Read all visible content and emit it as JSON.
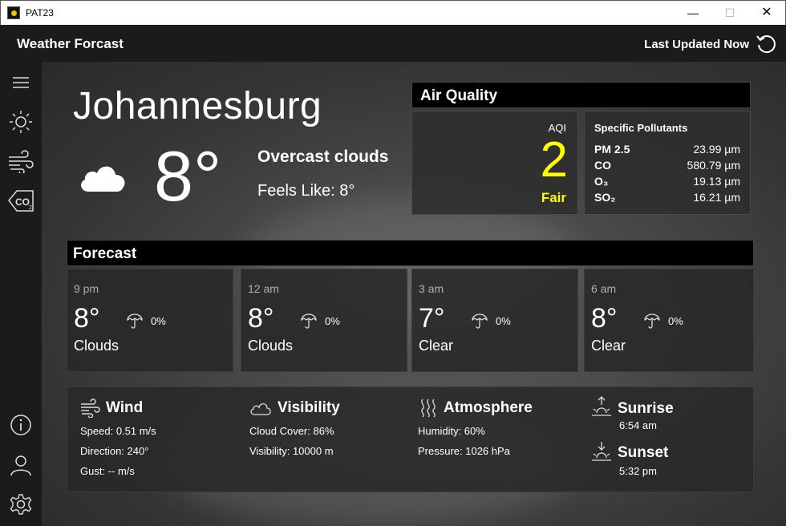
{
  "window": {
    "title": "PAT23",
    "minimize": "—",
    "maximize": "☐",
    "close": "✕"
  },
  "header": {
    "title": "Weather Forcast",
    "last_updated": "Last Updated Now"
  },
  "current": {
    "city": "Johannesburg",
    "temperature": "8°",
    "condition": "Overcast clouds",
    "feels_like": "Feels Like: 8°"
  },
  "air_quality": {
    "title": "Air Quality",
    "aqi_label": "AQI",
    "aqi_value": "2",
    "aqi_status": "Fair",
    "aqi_color": "#ffff00",
    "pollutants_title": "Specific Pollutants",
    "pollutants": [
      {
        "name": "PM 2.5",
        "value": "23.99 µm"
      },
      {
        "name": "CO",
        "value": "580.79 µm"
      },
      {
        "name": "O₃",
        "value": "19.13 µm"
      },
      {
        "name": "SO₂",
        "value": "16.21 µm"
      }
    ]
  },
  "forecast": {
    "title": "Forecast",
    "items": [
      {
        "time": "9 pm",
        "temp": "8°",
        "precip": "0%",
        "condition": "Clouds"
      },
      {
        "time": "12 am",
        "temp": "8°",
        "precip": "0%",
        "condition": "Clouds"
      },
      {
        "time": "3 am",
        "temp": "7°",
        "precip": "0%",
        "condition": "Clear"
      },
      {
        "time": "6 am",
        "temp": "8°",
        "precip": "0%",
        "condition": "Clear"
      }
    ]
  },
  "details": {
    "wind": {
      "title": "Wind",
      "speed": "Speed: 0.51 m/s",
      "direction": "Direction: 240°",
      "gust": "Gust: -- m/s"
    },
    "visibility": {
      "title": "Visibility",
      "cloud_cover": "Cloud Cover: 86%",
      "visibility": "Visibility: 10000 m"
    },
    "atmosphere": {
      "title": "Atmosphere",
      "humidity": "Humidity: 60%",
      "pressure": "Pressure: 1026 hPa"
    },
    "sunrise": {
      "title": "Sunrise",
      "time": "6:54 am"
    },
    "sunset": {
      "title": "Sunset",
      "time": "5:32 pm"
    }
  },
  "sidebar": {
    "icons": [
      "menu-icon",
      "sun-icon",
      "wind-icon",
      "co2-icon",
      "info-icon",
      "user-icon",
      "gear-icon"
    ]
  }
}
